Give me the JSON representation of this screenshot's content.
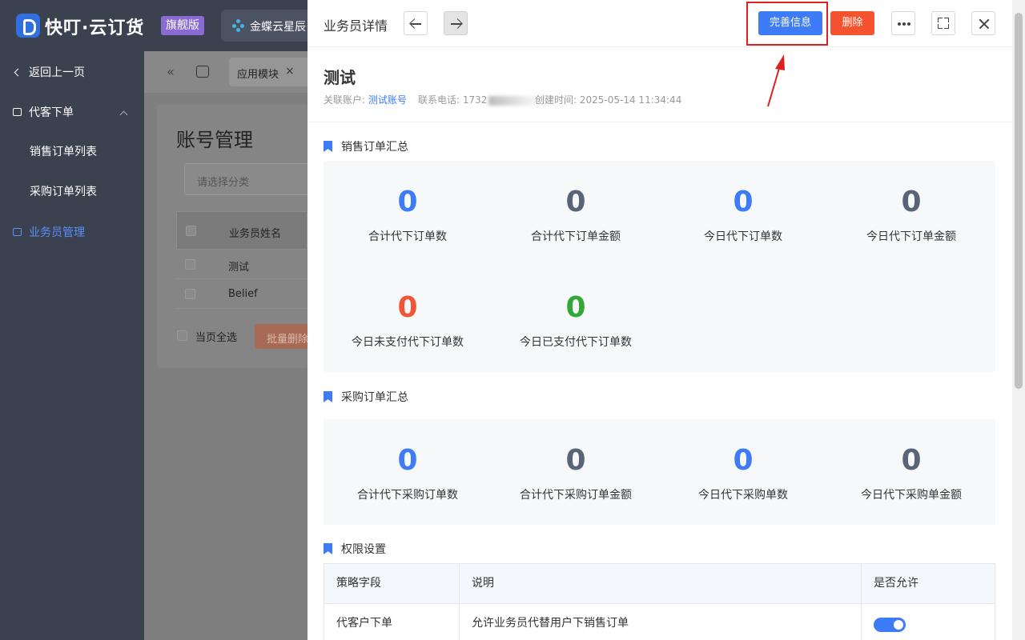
{
  "app": {
    "brand": "快叮·云订货",
    "edition": "旗舰版",
    "integration_tab": "金蝶云星辰"
  },
  "sidebar": {
    "back": "返回上一页",
    "group": "代客下单",
    "items": [
      {
        "label": "销售订单列表"
      },
      {
        "label": "采购订单列表"
      },
      {
        "label": "业务员管理",
        "active": true
      }
    ]
  },
  "background_page": {
    "tab_label": "应用模块",
    "title": "账号管理",
    "category_placeholder": "请选择分类",
    "column_header": "业务员姓名",
    "rows": [
      "测试",
      "Belief"
    ],
    "select_all": "当页全选",
    "batch_delete": "批量删除"
  },
  "drawer": {
    "title": "业务员详情",
    "complete_info_button": "完善信息",
    "delete_button": "删除",
    "user": {
      "name": "测试",
      "account_label": "关联账户:",
      "account_value": "测试账号",
      "phone_label": "联系电话:",
      "phone_value": "1732",
      "created_label": "创建时间:",
      "created_value": "2025-05-14 11:34:44"
    },
    "sales_summary": {
      "title": "销售订单汇总",
      "stats": [
        {
          "value": "0",
          "label": "合计代下订单数",
          "color": "#3d7bf7"
        },
        {
          "value": "0",
          "label": "合计代下订单金额",
          "color": "#5a6478"
        },
        {
          "value": "0",
          "label": "今日代下订单数",
          "color": "#3d7bf7"
        },
        {
          "value": "0",
          "label": "今日代下订单金额",
          "color": "#5a6478"
        },
        {
          "value": "0",
          "label": "今日未支付代下订单数",
          "color": "#f0553a"
        },
        {
          "value": "0",
          "label": "今日已支付代下订单数",
          "color": "#33a83a"
        }
      ]
    },
    "purchase_summary": {
      "title": "采购订单汇总",
      "stats": [
        {
          "value": "0",
          "label": "合计代下采购订单数",
          "color": "#3d7bf7"
        },
        {
          "value": "0",
          "label": "合计代下采购订单金额",
          "color": "#5a6478"
        },
        {
          "value": "0",
          "label": "今日代下采购单数",
          "color": "#3d7bf7"
        },
        {
          "value": "0",
          "label": "今日代下采购单金额",
          "color": "#5a6478"
        }
      ]
    },
    "permissions": {
      "title": "权限设置",
      "headers": [
        "策略字段",
        "说明",
        "是否允许"
      ],
      "rows": [
        {
          "field": "代客户下单",
          "desc": "允许业务员代替用户下销售订单",
          "allowed": true
        }
      ]
    }
  }
}
